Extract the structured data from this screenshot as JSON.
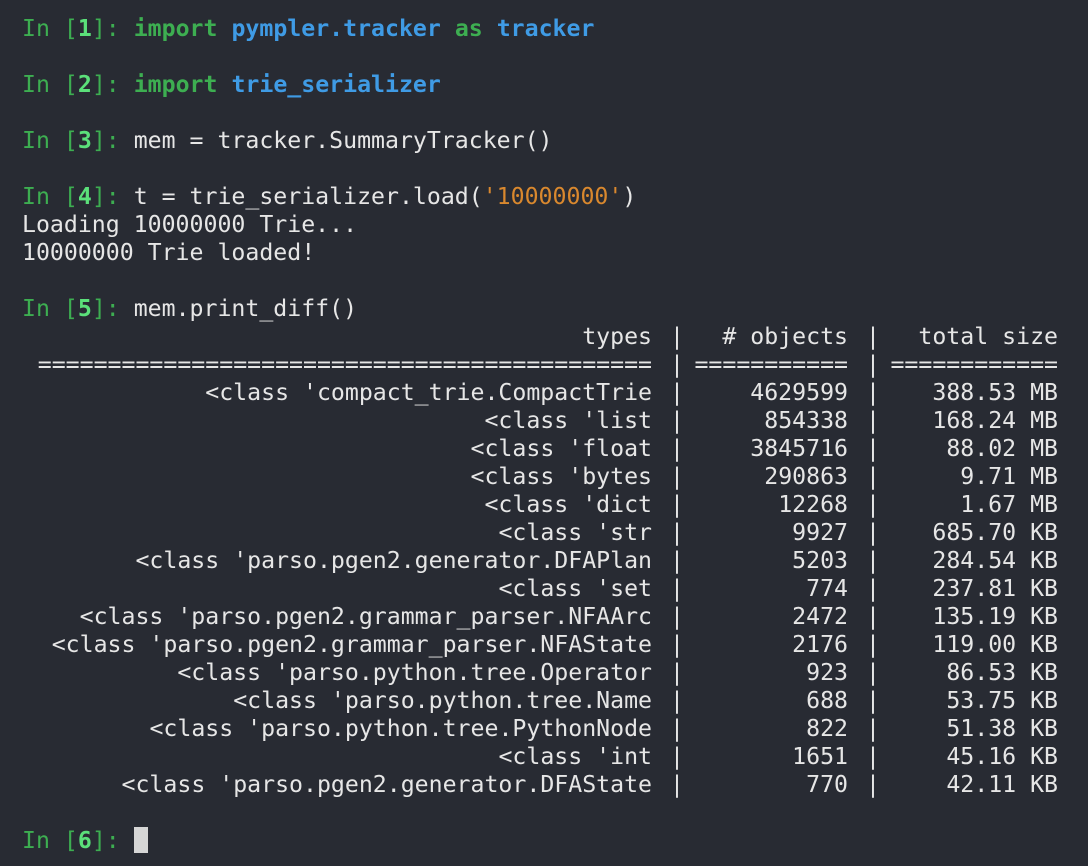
{
  "prompt": {
    "prefix": "In [",
    "suffix": "]: "
  },
  "inputs": [
    {
      "n": "1",
      "kw1": "import",
      "mod": "pympler.tracker",
      "kw2": "as",
      "alias": "tracker"
    },
    {
      "n": "2",
      "kw1": "import",
      "mod": "trie_serializer"
    },
    {
      "n": "3",
      "code": "mem = tracker.SummaryTracker()"
    },
    {
      "n": "4",
      "code_pre": "t = trie_serializer.load(",
      "str": "'10000000'",
      "code_post": ")"
    },
    {
      "n": "5",
      "code": "mem.print_diff()"
    },
    {
      "n": "6"
    }
  ],
  "outputs": {
    "load_line1": "Loading 10000000 Trie...",
    "load_line2": "10000000 Trie loaded!"
  },
  "table": {
    "headers": {
      "types": "types",
      "objects": "# objects",
      "size": "total size"
    },
    "sep_char": "|",
    "rules": {
      "types": "============================================",
      "objects": "===========",
      "size": "============"
    },
    "rows": [
      {
        "type": "<class 'compact_trie.CompactTrie",
        "objects": "4629599",
        "size": "388.53 MB"
      },
      {
        "type": "<class 'list",
        "objects": "854338",
        "size": "168.24 MB"
      },
      {
        "type": "<class 'float",
        "objects": "3845716",
        "size": "88.02 MB"
      },
      {
        "type": "<class 'bytes",
        "objects": "290863",
        "size": "9.71 MB"
      },
      {
        "type": "<class 'dict",
        "objects": "12268",
        "size": "1.67 MB"
      },
      {
        "type": "<class 'str",
        "objects": "9927",
        "size": "685.70 KB"
      },
      {
        "type": "<class 'parso.pgen2.generator.DFAPlan",
        "objects": "5203",
        "size": "284.54 KB"
      },
      {
        "type": "<class 'set",
        "objects": "774",
        "size": "237.81 KB"
      },
      {
        "type": "<class 'parso.pgen2.grammar_parser.NFAArc",
        "objects": "2472",
        "size": "135.19 KB"
      },
      {
        "type": "<class 'parso.pgen2.grammar_parser.NFAState",
        "objects": "2176",
        "size": "119.00 KB"
      },
      {
        "type": "<class 'parso.python.tree.Operator",
        "objects": "923",
        "size": "86.53 KB"
      },
      {
        "type": "<class 'parso.python.tree.Name",
        "objects": "688",
        "size": "53.75 KB"
      },
      {
        "type": "<class 'parso.python.tree.PythonNode",
        "objects": "822",
        "size": "51.38 KB"
      },
      {
        "type": "<class 'int",
        "objects": "1651",
        "size": "45.16 KB"
      },
      {
        "type": "<class 'parso.pgen2.generator.DFAState",
        "objects": "770",
        "size": "42.11 KB"
      }
    ]
  }
}
